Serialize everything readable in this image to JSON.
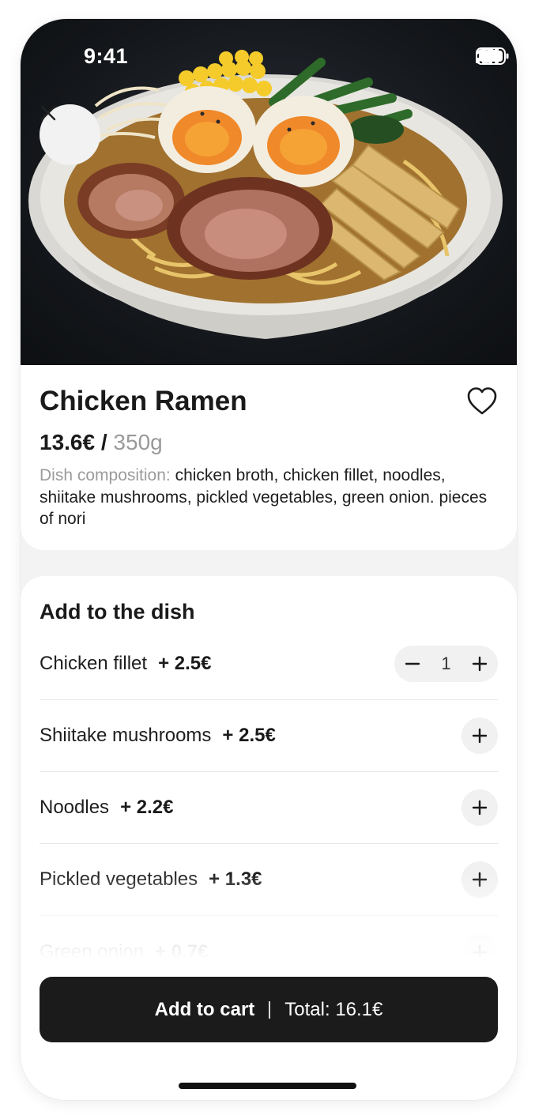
{
  "status_bar": {
    "time": "9:41"
  },
  "dish": {
    "title": "Chicken Ramen",
    "price": "13.6€",
    "separator": "/",
    "weight": "350g",
    "composition_label": "Dish composition:",
    "composition": "chicken broth, chicken fillet, noodles, shiitake mushrooms, pickled vegetables, green onion. pieces of nori"
  },
  "add_section": {
    "title": "Add to the dish",
    "options": [
      {
        "name": "Chicken fillet",
        "price": "+ 2.5€",
        "quantity": "1"
      },
      {
        "name": "Shiitake mushrooms",
        "price": "+ 2.5€"
      },
      {
        "name": "Noodles",
        "price": "+ 2.2€"
      },
      {
        "name": "Pickled vegetables",
        "price": "+ 1.3€"
      },
      {
        "name": "Green onion",
        "price": "+ 0.7€"
      }
    ]
  },
  "cart": {
    "label": "Add to cart",
    "total": "Total: 16.1€"
  },
  "icons": {
    "close": "close-icon",
    "favorite": "heart-outline-icon",
    "minus": "minus-icon",
    "plus": "plus-icon",
    "signal": "cellular-signal-icon",
    "wifi": "wifi-icon",
    "battery": "battery-icon"
  },
  "colors": {
    "button_dark": "#1b1b1b",
    "muted_text": "#9b9b9b",
    "control_bg": "#f1f1f1"
  }
}
